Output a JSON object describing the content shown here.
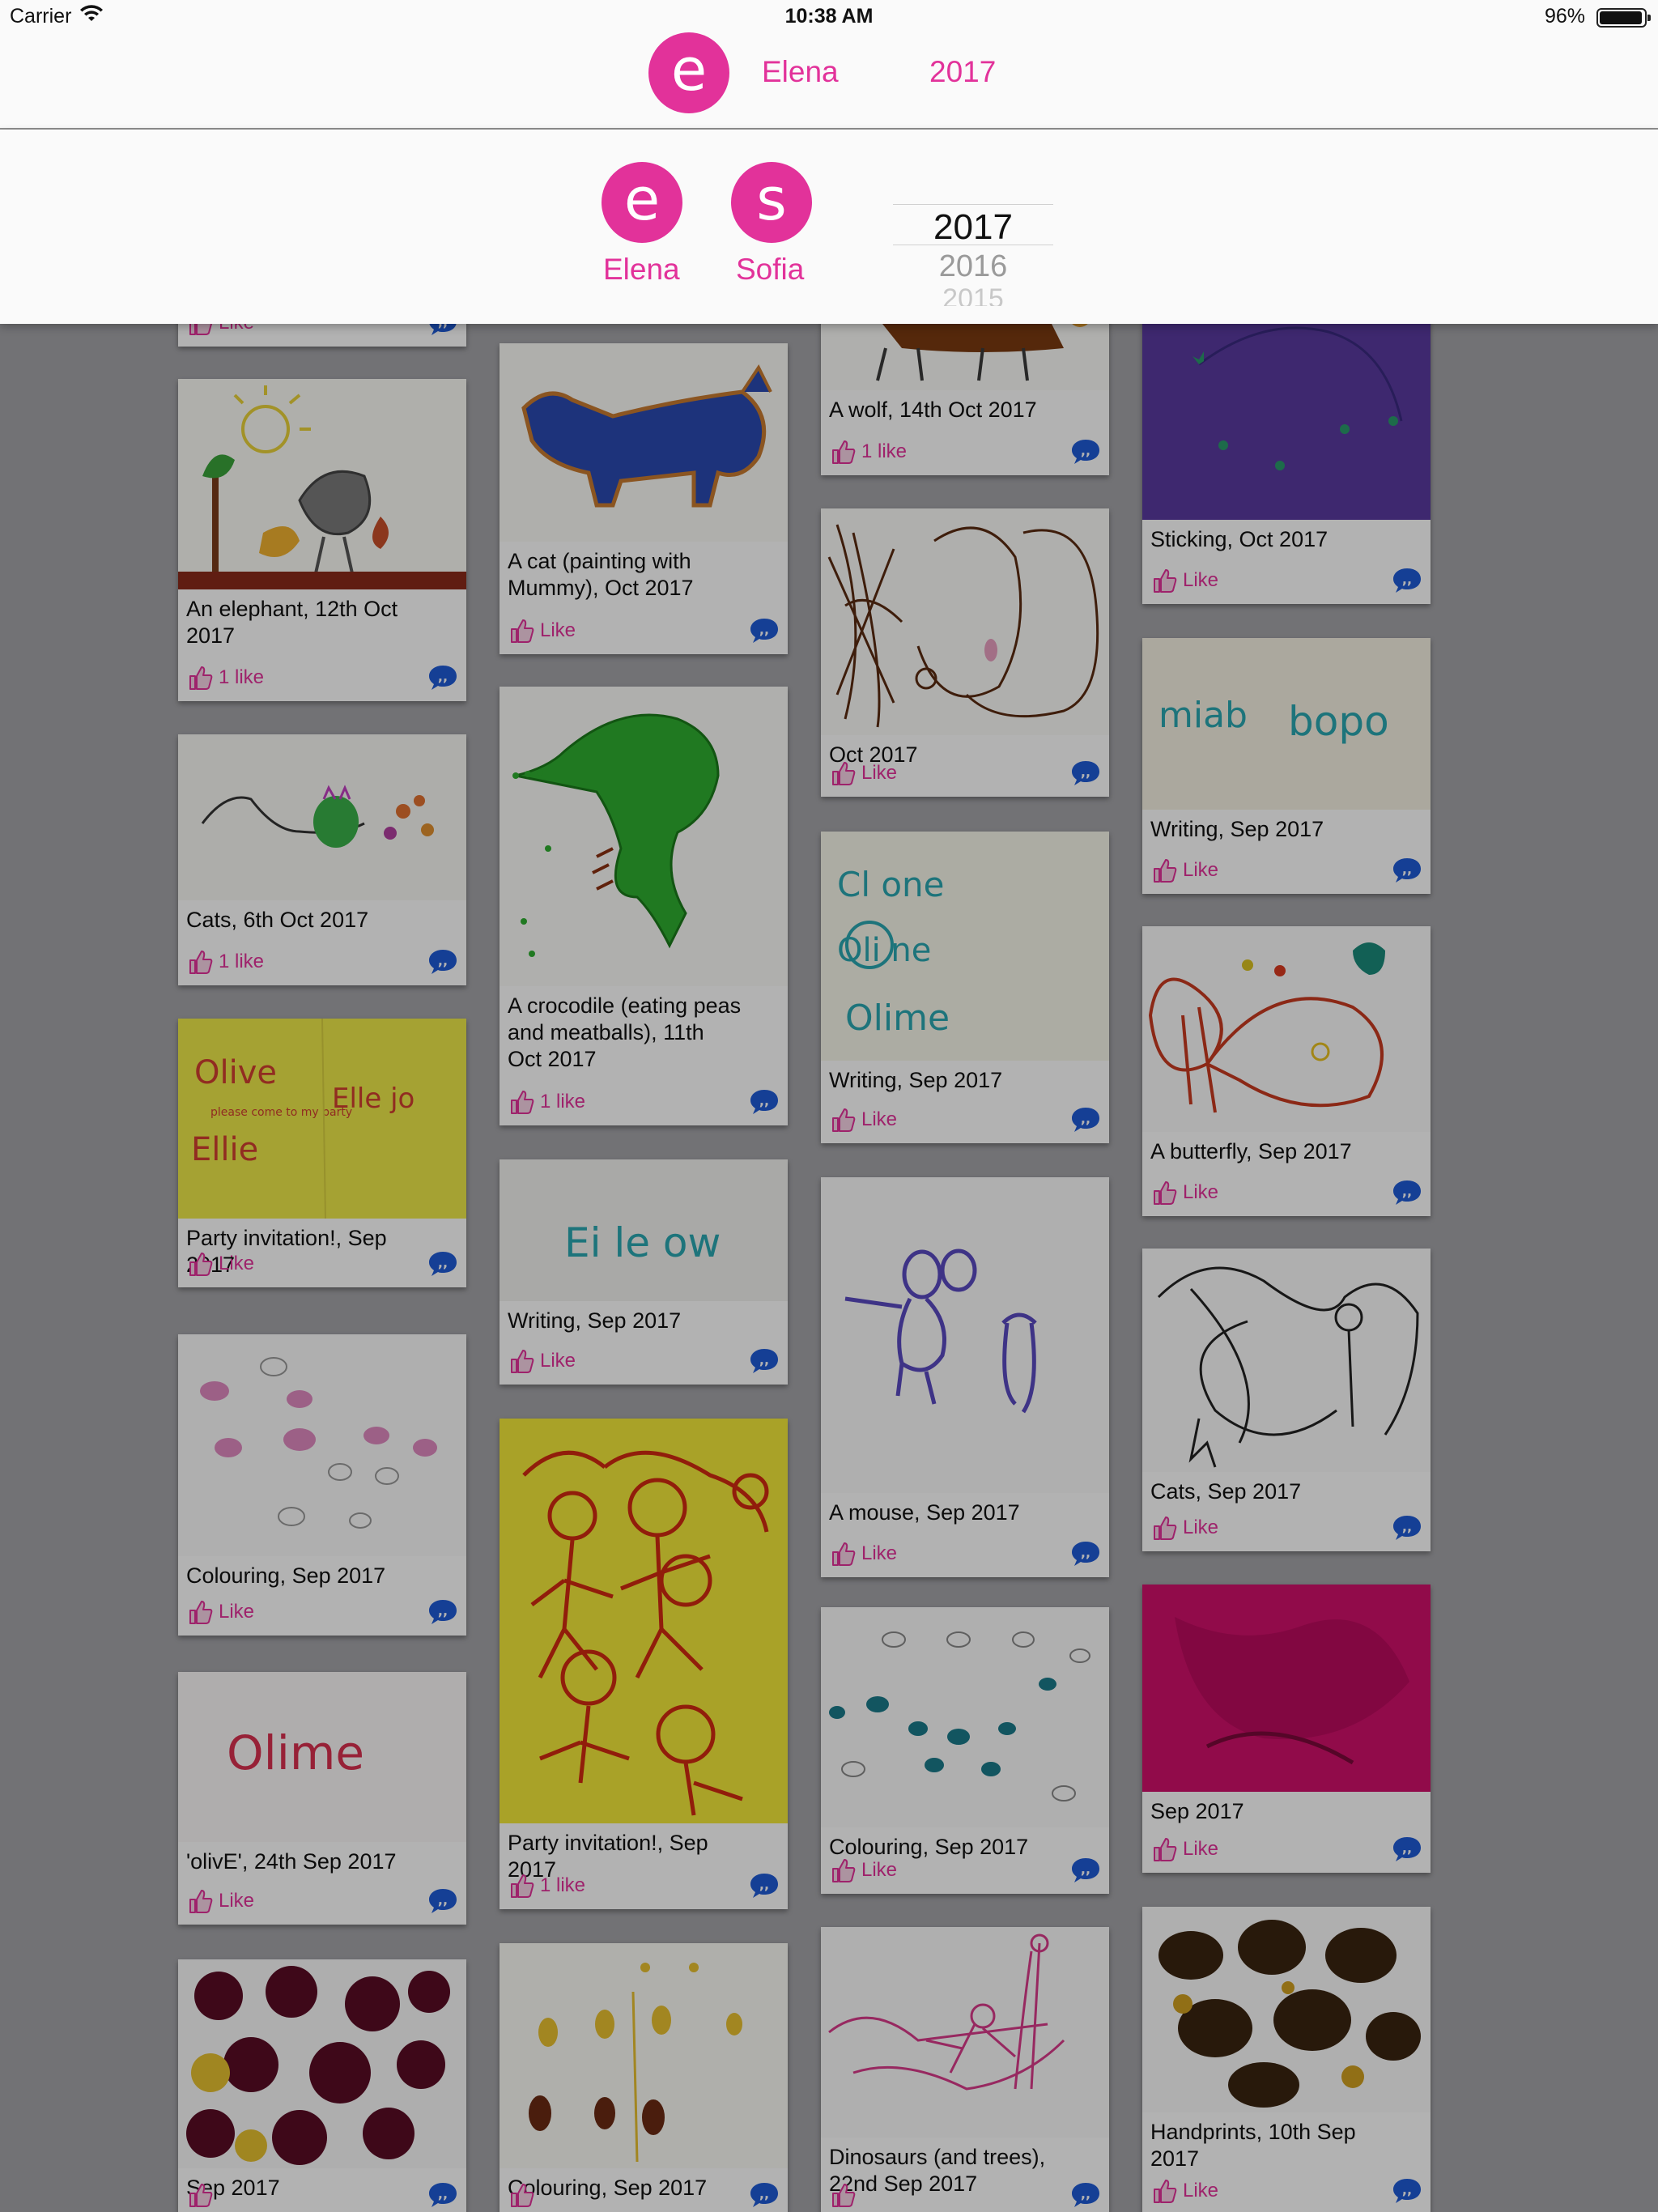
{
  "status_bar": {
    "carrier": "Carrier",
    "time": "10:38 AM",
    "battery": "96%"
  },
  "header": {
    "avatar_letter": "e",
    "child_name": "Elena",
    "year": "2017"
  },
  "picker": {
    "children": [
      {
        "letter": "e",
        "name": "Elena"
      },
      {
        "letter": "s",
        "name": "Sofia"
      }
    ],
    "years": [
      "2017",
      "2016",
      "2015"
    ]
  },
  "colors": {
    "accent": "#e2329a",
    "comment_blue": "#1f5bd6"
  },
  "gallery": {
    "cards": [
      {
        "caption": "",
        "like": "Like",
        "art": "blank"
      },
      {
        "caption": "An elephant, 12th Oct 2017",
        "like": "1 like",
        "art": "elephant"
      },
      {
        "caption": "Cats, 6th Oct 2017",
        "like": "1 like",
        "art": "cats"
      },
      {
        "caption": "Party invitation!, Sep 2017",
        "like": "Like",
        "art": "invitation"
      },
      {
        "caption": "Colouring, Sep 2017",
        "like": "Like",
        "art": "colouring-pink"
      },
      {
        "caption": "'olivE', 24th Sep 2017",
        "like": "Like",
        "art": "olive"
      },
      {
        "caption": "Sep 2017",
        "like": "",
        "art": "blobs-dark"
      },
      {
        "caption": "A cat (painting with Mummy), Oct 2017",
        "like": "Like",
        "art": "blue-cat"
      },
      {
        "caption": "A crocodile (eating peas and meatballs), 11th Oct 2017",
        "like": "1 like",
        "art": "crocodile"
      },
      {
        "caption": "Writing, Sep 2017",
        "like": "Like",
        "art": "writing-eileen"
      },
      {
        "caption": "Party invitation!, Sep 2017",
        "like": "1 like",
        "art": "yellow-figures"
      },
      {
        "caption": "Colouring, Sep 2017",
        "like": "",
        "art": "colouring-yellow"
      },
      {
        "caption": "A wolf, 14th Oct 2017",
        "like": "1 like",
        "art": "wolf"
      },
      {
        "caption": "Oct 2017",
        "like": "Like",
        "art": "scribble"
      },
      {
        "caption": "Writing, Sep 2017",
        "like": "Like",
        "art": "writing-clone"
      },
      {
        "caption": "A mouse, Sep 2017",
        "like": "Like",
        "art": "mouse"
      },
      {
        "caption": "Colouring, Sep 2017",
        "like": "Like",
        "art": "colouring-blue"
      },
      {
        "caption": "Dinosaurs (and trees), 22nd Sep 2017",
        "like": "",
        "art": "dinosaurs"
      },
      {
        "caption": "Sticking, Oct 2017",
        "like": "Like",
        "art": "purple"
      },
      {
        "caption": "Writing, Sep 2017",
        "like": "Like",
        "art": "writing-miab"
      },
      {
        "caption": "A butterfly, Sep 2017",
        "like": "Like",
        "art": "butterfly"
      },
      {
        "caption": "Cats, Sep 2017",
        "like": "Like",
        "art": "cat-sketch"
      },
      {
        "caption": "Sep 2017",
        "like": "Like",
        "art": "magenta"
      },
      {
        "caption": "Handprints, 10th Sep 2017",
        "like": "Like",
        "art": "handprints"
      }
    ]
  }
}
